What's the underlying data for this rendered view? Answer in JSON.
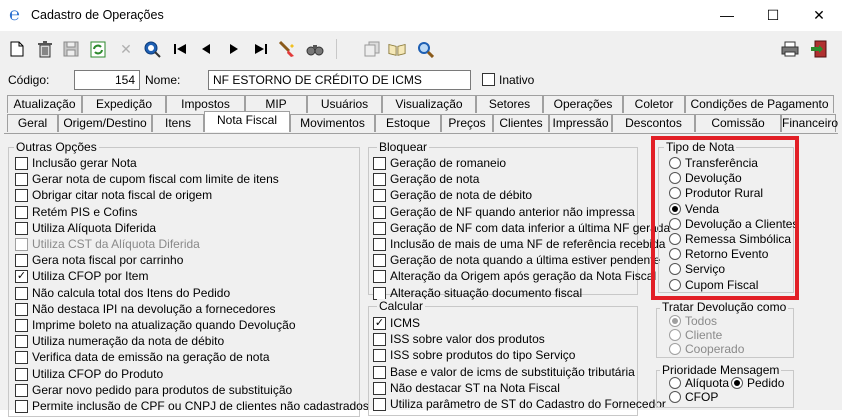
{
  "window": {
    "title": "Cadastro de Operações",
    "minimize": "—",
    "maximize": "☐",
    "close": "✕"
  },
  "toolbar_icons": [
    "new-document-icon",
    "delete-icon",
    "save-icon",
    "refresh-icon",
    "cancel-icon",
    "search-icon",
    "first-record-icon",
    "previous-record-icon",
    "next-record-icon",
    "last-record-icon",
    "clear-filter-icon",
    "find-icon",
    "copy-icon",
    "open-book-icon",
    "zoom-icon",
    "print-icon",
    "exit-icon"
  ],
  "header": {
    "codigo_label": "Código:",
    "codigo_value": "154",
    "nome_label": "Nome:",
    "nome_value": "NF ESTORNO DE CRÉDITO DE ICMS",
    "inativo_label": "Inativo"
  },
  "tabs_row1": [
    "Atualização",
    "Expedição",
    "Impostos",
    "MIP",
    "Usuários",
    "Visualização",
    "Setores",
    "Operações",
    "Coletor",
    "Condições de Pagamento"
  ],
  "tabs_row2": [
    "Geral",
    "Origem/Destino",
    "Itens",
    "Nota Fiscal",
    "Movimentos",
    "Estoque",
    "Preços",
    "Clientes",
    "Impressão",
    "Descontos",
    "Comissão",
    "Financeiro"
  ],
  "active_tab": "Nota Fiscal",
  "outras_opcoes": {
    "title": "Outras Opções",
    "items": [
      {
        "label": "Inclusão gerar Nota",
        "checked": false,
        "disabled": false
      },
      {
        "label": "Gerar nota de cupom fiscal com limite de itens",
        "checked": false,
        "disabled": false
      },
      {
        "label": "Obrigar citar nota fiscal de origem",
        "checked": false,
        "disabled": false
      },
      {
        "label": "Retém PIS e Cofins",
        "checked": false,
        "disabled": false
      },
      {
        "label": "Utiliza Alíquota Diferida",
        "checked": false,
        "disabled": false
      },
      {
        "label": "Utiliza CST da Alíquota Diferida",
        "checked": false,
        "disabled": true
      },
      {
        "label": "Gera nota fiscal por carrinho",
        "checked": false,
        "disabled": false
      },
      {
        "label": "Utiliza CFOP por Item",
        "checked": true,
        "disabled": false
      },
      {
        "label": "Não calcula total dos Itens do Pedido",
        "checked": false,
        "disabled": false
      },
      {
        "label": "Não destaca IPI na devolução a fornecedores",
        "checked": false,
        "disabled": false
      },
      {
        "label": "Imprime boleto na atualização quando Devolução",
        "checked": false,
        "disabled": false
      },
      {
        "label": "Utiliza numeração da nota de débito",
        "checked": false,
        "disabled": false
      },
      {
        "label": "Verifica data de emissão na geração de nota",
        "checked": false,
        "disabled": false
      },
      {
        "label": "Utiliza CFOP do Produto",
        "checked": false,
        "disabled": false
      },
      {
        "label": "Gerar novo pedido para produtos de substituição",
        "checked": false,
        "disabled": false
      },
      {
        "label": "Permite inclusão de CPF ou CNPJ de clientes não cadastrados",
        "checked": false,
        "disabled": false
      }
    ]
  },
  "bloquear": {
    "title": "Bloquear",
    "items": [
      {
        "label": "Geração de romaneio",
        "checked": false
      },
      {
        "label": "Geração de nota",
        "checked": false
      },
      {
        "label": "Geração de nota de débito",
        "checked": false
      },
      {
        "label": "Geração de NF quando anterior não impressa",
        "checked": false
      },
      {
        "label": "Geração de NF com data inferior a última NF gerada",
        "checked": false
      },
      {
        "label": "Inclusão de mais de uma NF de referência recebida",
        "checked": false
      },
      {
        "label": "Geração de nota quando a última estiver pendente",
        "checked": false
      },
      {
        "label": "Alteração da Origem após geração da Nota Fiscal",
        "checked": false
      },
      {
        "label": "Alteração situação documento fiscal",
        "checked": false
      }
    ]
  },
  "calcular": {
    "title": "Calcular",
    "items": [
      {
        "label": "ICMS",
        "checked": true
      },
      {
        "label": "ISS sobre valor dos produtos",
        "checked": false
      },
      {
        "label": "ISS sobre produtos do tipo Serviço",
        "checked": false
      },
      {
        "label": "Base e valor de icms de substituição tributária",
        "checked": false
      },
      {
        "label": "Não destacar ST na Nota Fiscal",
        "checked": false
      },
      {
        "label": "Utiliza parâmetro de ST do Cadastro do Fornecedor",
        "checked": false
      }
    ]
  },
  "tipo_nota": {
    "title": "Tipo de Nota",
    "options": [
      "Transferência",
      "Devolução",
      "Produtor Rural",
      "Venda",
      "Devolução a Clientes",
      "Remessa Simbólica",
      "Retorno Evento",
      "Serviço",
      "Cupom Fiscal"
    ],
    "selected": "Venda",
    "highlight_color": "#e21f26"
  },
  "tratar_devolucao": {
    "title": "Tratar Devolução como",
    "options": [
      "Todos",
      "Cliente",
      "Cooperado"
    ],
    "selected": "Todos",
    "disabled": true
  },
  "prioridade": {
    "title": "Prioridade Mensagem",
    "options": [
      "Alíquota",
      "Pedido",
      "CFOP"
    ],
    "selected": "Pedido"
  }
}
